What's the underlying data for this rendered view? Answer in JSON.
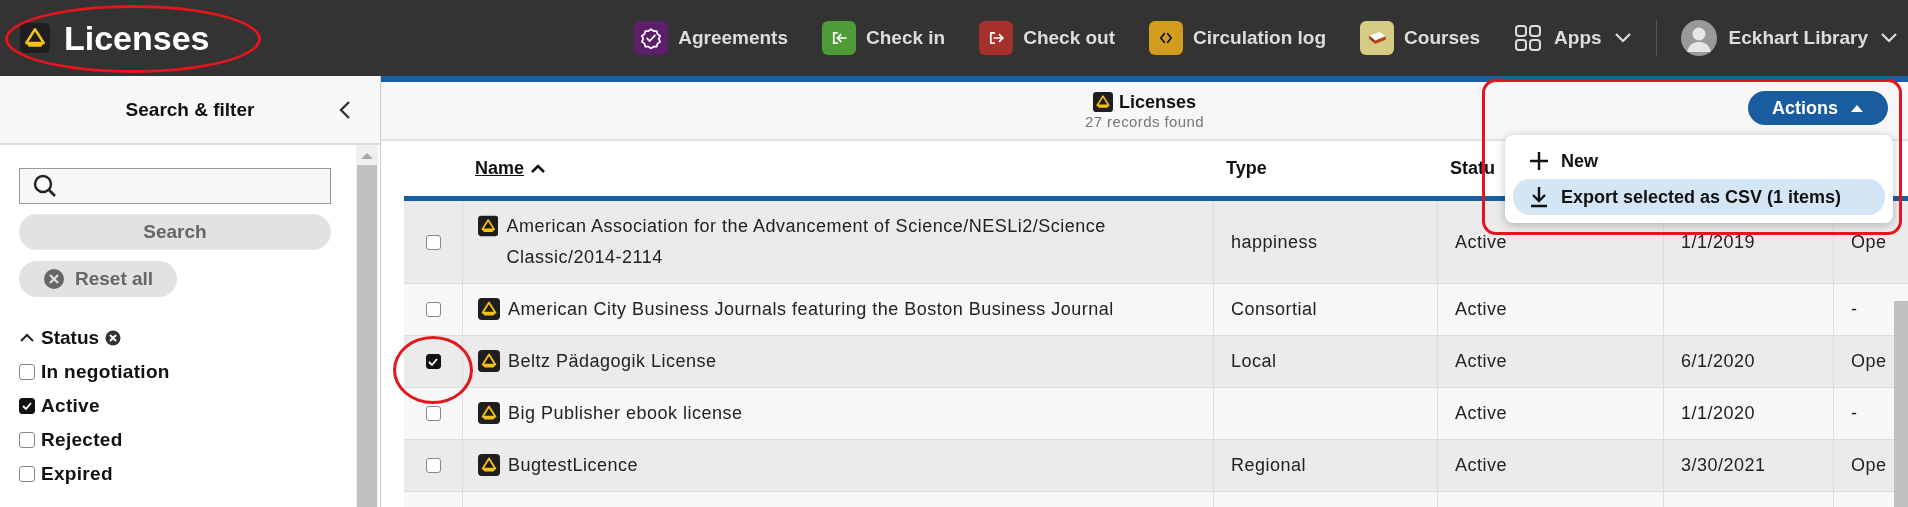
{
  "app_title": "Licenses",
  "nav": [
    {
      "label": "Agreements",
      "color": "#5b1f6b",
      "kind": "badge"
    },
    {
      "label": "Check in",
      "color": "#4f9b38",
      "kind": "enter"
    },
    {
      "label": "Check out",
      "color": "#a6302b",
      "kind": "exit"
    },
    {
      "label": "Circulation log",
      "color": "#d29c1c",
      "kind": "code"
    },
    {
      "label": "Courses",
      "color": "#d6cb85",
      "kind": "book"
    }
  ],
  "apps_menu": {
    "label": "Apps"
  },
  "user_menu": {
    "label": "Eckhart Library"
  },
  "filter_pane": {
    "title": "Search & filter",
    "search_button": "Search",
    "reset_button": "Reset all",
    "status_filter": {
      "label": "Status",
      "expanded": true,
      "options": [
        {
          "label": "In negotiation",
          "checked": false
        },
        {
          "label": "Active",
          "checked": true
        },
        {
          "label": "Rejected",
          "checked": false
        },
        {
          "label": "Expired",
          "checked": false
        }
      ]
    }
  },
  "results": {
    "title": "Licenses",
    "count": "27 records found"
  },
  "actions": {
    "label": "Actions",
    "expanded": true,
    "items": [
      {
        "kind": "new",
        "label": "New",
        "selected": false
      },
      {
        "kind": "export",
        "label": "Export selected as CSV (1 items)",
        "selected": true
      }
    ]
  },
  "table": {
    "columns": [
      {
        "label": "Name",
        "sorted": true
      },
      {
        "label": "Type",
        "sorted": false
      },
      {
        "label": "Statu",
        "sorted": false
      }
    ],
    "rows": [
      {
        "selected": false,
        "name": "American Association for the Advancement of Science/NESLi2/Science Classic/2014-2114",
        "type": "happiness",
        "status": "Active",
        "column_5": "1/1/2019",
        "column_6": "Ope"
      },
      {
        "selected": false,
        "name": "American City Business Journals featuring the Boston Business Journal",
        "type": "Consortial",
        "status": "Active",
        "column_5": "",
        "column_6": "-"
      },
      {
        "selected": true,
        "name": "Beltz Pädagogik License",
        "type": "Local",
        "status": "Active",
        "column_5": "6/1/2020",
        "column_6": "Ope"
      },
      {
        "selected": false,
        "name": "Big Publisher ebook license",
        "type": "",
        "status": "Active",
        "column_5": "1/1/2020",
        "column_6": "-"
      },
      {
        "selected": false,
        "name": "BugtestLicence",
        "type": "Regional",
        "status": "Active",
        "column_5": "3/30/2021",
        "column_6": "Ope"
      }
    ]
  }
}
